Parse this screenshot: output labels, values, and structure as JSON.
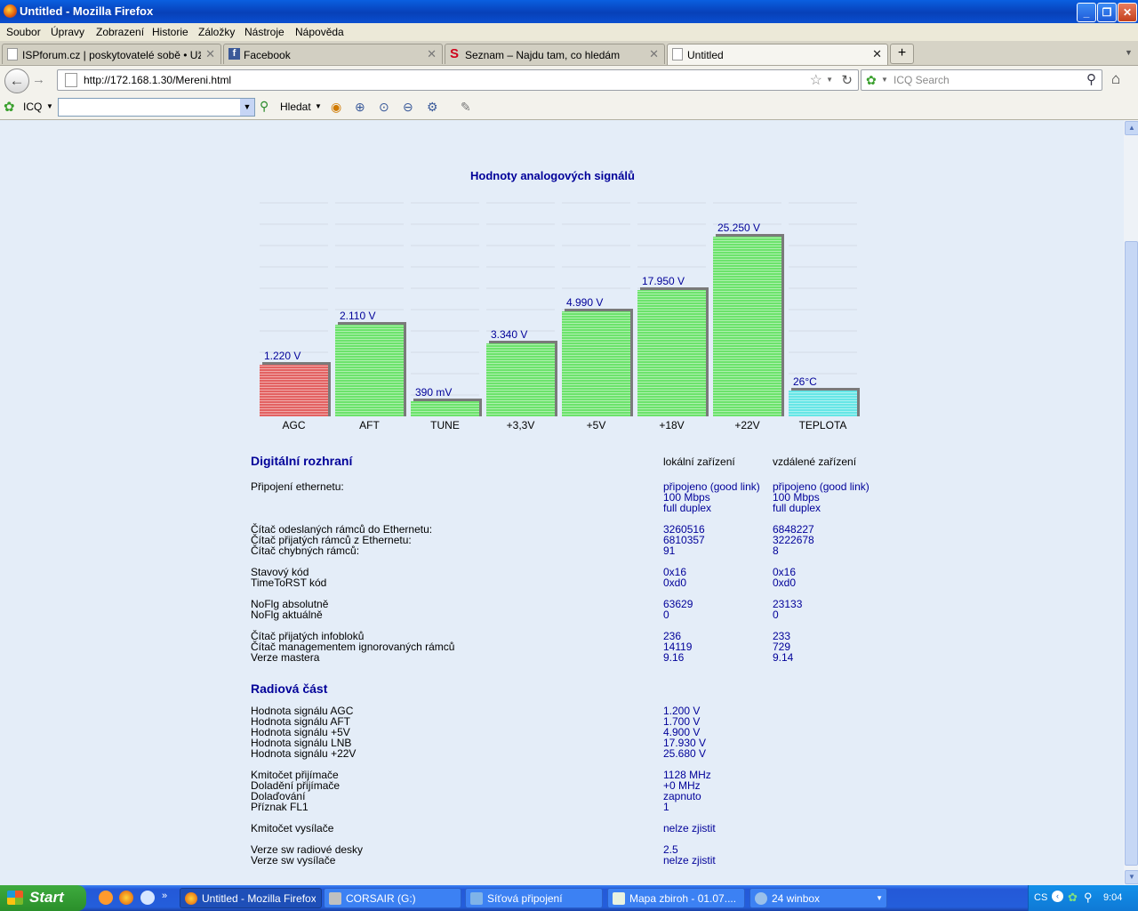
{
  "window": {
    "title": "Untitled - Mozilla Firefox",
    "minimize": "_",
    "maximize": "❐",
    "close": "✕"
  },
  "menu": [
    "Soubor",
    "Úpravy",
    "Zobrazení",
    "Historie",
    "Záložky",
    "Nástroje",
    "Nápověda"
  ],
  "tabs": [
    {
      "label": "ISPforum.cz | poskytovatelé sobě • Uživ...",
      "icon": "page-icon"
    },
    {
      "label": "Facebook",
      "icon": "facebook-icon"
    },
    {
      "label": "Seznam – Najdu tam, co hledám",
      "icon": "seznam-icon"
    },
    {
      "label": "Untitled",
      "icon": "page-icon",
      "active": true
    }
  ],
  "new_tab": "+",
  "nav": {
    "url": "http://172.168.1.30/Mereni.html",
    "search_placeholder": "ICQ Search"
  },
  "icq_toolbar": {
    "label": "ICQ",
    "search_button": "Hledat"
  },
  "page": {
    "chart_title": "Hodnoty analogových signálů",
    "digital": {
      "heading": "Digitální rozhraní",
      "col_local": "lokální zařízení",
      "col_remote": "vzdálené zařízení",
      "eth_label": "Připojení ethernetu:",
      "eth_local": [
        "připojeno (good link)",
        "100 Mbps",
        "full duplex"
      ],
      "eth_remote": [
        "připojeno (good link)",
        "100 Mbps",
        "full duplex"
      ],
      "counters_labels": [
        "Čítač odeslaných rámců do Ethernetu:",
        "Čítač přijatých rámců z Ethernetu:",
        "Čítač chybných rámců:"
      ],
      "counters_local": [
        "3260516",
        "6810357",
        "91"
      ],
      "counters_remote": [
        "6848227",
        "3222678",
        "8"
      ],
      "status_labels": [
        "Stavový kód",
        "TimeToRST kód"
      ],
      "status_local": [
        "0x16",
        "0xd0"
      ],
      "status_remote": [
        "0x16",
        "0xd0"
      ],
      "nofig_labels": [
        "NoFlg absolutně",
        "NoFlg aktuálně"
      ],
      "nofig_local": [
        "63629",
        "0"
      ],
      "nofig_remote": [
        "23133",
        "0"
      ],
      "info_labels": [
        "Čítač přijatých infobloků",
        "Čítač managementem ignorovaných rámců",
        "Verze mastera"
      ],
      "info_local": [
        "236",
        "14119",
        "9.16"
      ],
      "info_remote": [
        "233",
        "729",
        "9.14"
      ]
    },
    "radio": {
      "heading": "Radiová část",
      "signal_labels": [
        "Hodnota signálu AGC",
        "Hodnota signálu AFT",
        "Hodnota signálu +5V",
        "Hodnota signálu LNB",
        "Hodnota signálu +22V"
      ],
      "signal_values": [
        "1.200 V",
        "1.700 V",
        "4.900 V",
        "17.930 V",
        "25.680 V"
      ],
      "rx_labels": [
        "Kmitočet přijímače",
        "Doladění přijímače",
        "Dolaďování",
        "Příznak FL1"
      ],
      "rx_values": [
        "1128 MHz",
        "+0 MHz",
        "zapnuto",
        "1"
      ],
      "tx_label": "Kmitočet vysílače",
      "tx_value": "nelze zjistit",
      "sw_labels": [
        "Verze sw radiové desky",
        "Verze sw vysílače"
      ],
      "sw_values": [
        "2.5",
        "nelze zjistit"
      ]
    }
  },
  "chart_data": {
    "type": "bar",
    "title": "Hodnoty analogových signálů",
    "categories": [
      "AGC",
      "AFT",
      "TUNE",
      "+3,3V",
      "+5V",
      "+18V",
      "+22V",
      "TEPLOTA"
    ],
    "value_labels": [
      "1.220 V",
      "2.110 V",
      "390 mV",
      "3.340 V",
      "4.990 V",
      "17.950 V",
      "25.250 V",
      "26°C"
    ],
    "fill_fraction": [
      0.24,
      0.43,
      0.07,
      0.34,
      0.49,
      0.59,
      0.84,
      0.12
    ],
    "colors": [
      "#e36262",
      "#6ce36c",
      "#6ce36c",
      "#6ce36c",
      "#6ce36c",
      "#6ce36c",
      "#6ce36c",
      "#66e6e6"
    ]
  },
  "taskbar": {
    "start": "Start",
    "tasks": [
      "Untitled - Mozilla Firefox",
      "CORSAIR (G:)",
      "Síťová připojení",
      "Mapa zbiroh - 01.07....",
      "24 winbox"
    ],
    "lang": "CS",
    "clock": "9:04"
  }
}
